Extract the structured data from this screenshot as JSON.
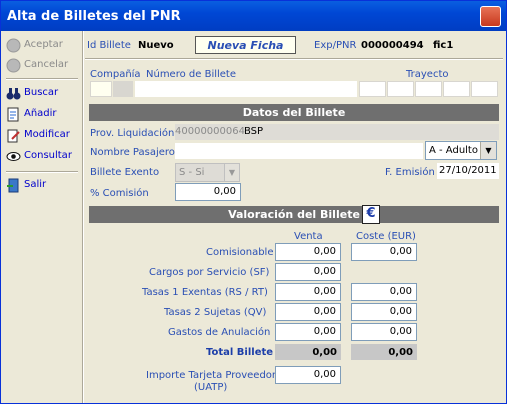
{
  "window": {
    "title": "Alta de Billetes del PNR"
  },
  "sidebar": {
    "accept": "Aceptar",
    "cancel": "Cancelar",
    "search": "Buscar",
    "add": "Añadir",
    "modify": "Modificar",
    "view": "Consultar",
    "exit": "Salir"
  },
  "header": {
    "id_label": "Id Billete",
    "id_value": "Nuevo",
    "mode": "Nueva Ficha",
    "exp_label": "Exp/PNR",
    "exp_value": "000000494",
    "fic_value": "fic1"
  },
  "top_row": {
    "company_label": "Compañía",
    "ticket_number_label": "Número de Billete",
    "route_label": "Trayecto"
  },
  "datos": {
    "section_title": "Datos del Billete",
    "prov_label": "Prov. Liquidación",
    "prov_code": "40000000064",
    "prov_name": "BSP",
    "passenger_label": "Nombre Pasajero",
    "passenger_value": "",
    "passenger_type": "A - Adulto",
    "exempt_label": "Billete Exento",
    "exempt_value": "S - Si",
    "emission_label": "F. Emisión",
    "emission_value": "27/10/2011",
    "commission_label": "% Comisión",
    "commission_value": "0,00"
  },
  "valoracion": {
    "section_title": "Valoración del Billete",
    "currency_symbol": "€",
    "col_venta": "Venta",
    "col_coste": "Coste (EUR)",
    "rows": [
      {
        "label": "Comisionable",
        "venta": "0,00",
        "coste": "0,00"
      },
      {
        "label": "Cargos por Servicio (SF)",
        "venta": "0,00",
        "coste": ""
      },
      {
        "label": "Tasas 1 Exentas (RS / RT)",
        "venta": "0,00",
        "coste": "0,00"
      },
      {
        "label": "Tasas 2 Sujetas (QV)",
        "venta": "0,00",
        "coste": "0,00"
      },
      {
        "label": "Gastos de Anulación",
        "venta": "0,00",
        "coste": "0,00"
      }
    ],
    "total_label": "Total Billete",
    "total_venta": "0,00",
    "total_coste": "0,00",
    "uatp_label_1": "Importe Tarjeta Proveedor",
    "uatp_label_2": "(UATP)",
    "uatp_value": "0,00"
  }
}
